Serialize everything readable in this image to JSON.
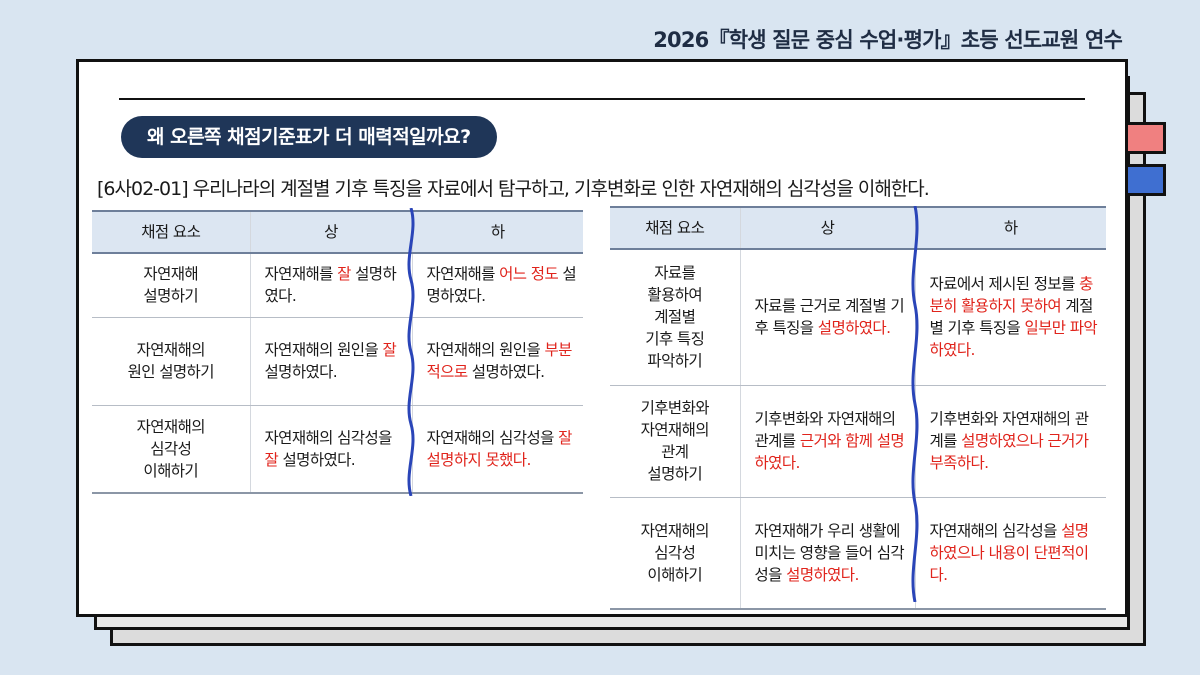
{
  "header": {
    "title": "2026『학생 질문 중심 수업·평가』초등 선도교원 연수"
  },
  "question": "왜 오른쪽 채점기준표가 더 매력적일까요?",
  "standard": "[6사02-01] 우리나라의 계절별 기후 특징을 자료에서 탐구하고, 기후변화로 인한 자연재해의 심각성을 이해한다.",
  "left_table": {
    "headers": [
      "채점 요소",
      "상",
      "하"
    ],
    "rows": [
      {
        "element": [
          "자연재해",
          "설명하기"
        ],
        "high": [
          {
            "t": "자연재해를 "
          },
          {
            "t": "잘",
            "r": 1
          },
          {
            "t": " 설명하였다."
          }
        ],
        "low": [
          {
            "t": "자연재해를 "
          },
          {
            "t": "어느 정도",
            "r": 1
          },
          {
            "t": " 설명하였다."
          }
        ]
      },
      {
        "element": [
          "자연재해의",
          "원인 설명하기"
        ],
        "high": [
          {
            "t": "자연재해의 원인을 "
          },
          {
            "t": "잘",
            "r": 1
          },
          {
            "t": " 설명하였다."
          }
        ],
        "low": [
          {
            "t": "자연재해의 원인을 "
          },
          {
            "t": "부분적으로",
            "r": 1
          },
          {
            "t": " 설명하였다."
          }
        ]
      },
      {
        "element": [
          "자연재해의",
          "심각성",
          "이해하기"
        ],
        "high": [
          {
            "t": "자연재해의 심각성을 "
          },
          {
            "t": "잘",
            "r": 1
          },
          {
            "t": " 설명하였다."
          }
        ],
        "low": [
          {
            "t": "자연재해의 심각성을 "
          },
          {
            "t": "잘 설명하지 못했다.",
            "r": 1
          }
        ]
      }
    ]
  },
  "right_table": {
    "headers": [
      "채점 요소",
      "상",
      "하"
    ],
    "rows": [
      {
        "element": [
          "자료를",
          "활용하여",
          "계절별",
          "기후 특징",
          "파악하기"
        ],
        "high": [
          {
            "t": "자료를 근거로 계절별 기후 특징을 "
          },
          {
            "t": "설명하였다.",
            "r": 1
          }
        ],
        "low": [
          {
            "t": "자료에서 제시된 정보를 "
          },
          {
            "t": "충분히 활용하지 못하여",
            "r": 1
          },
          {
            "t": " 계절별 기후 특징을 "
          },
          {
            "t": "일부만 파악하였다.",
            "r": 1
          }
        ]
      },
      {
        "element": [
          "기후변화와",
          "자연재해의",
          "관계",
          "설명하기"
        ],
        "high": [
          {
            "t": "기후변화와 자연재해의 관계를 "
          },
          {
            "t": "근거와 함께 설명하였다.",
            "r": 1
          }
        ],
        "low": [
          {
            "t": "기후변화와 자연재해의 관계를 "
          },
          {
            "t": "설명하였으나 근거가 부족하다.",
            "r": 1
          }
        ]
      },
      {
        "element": [
          "자연재해의",
          "심각성",
          "이해하기"
        ],
        "high": [
          {
            "t": "자연재해가 우리 생활에 미치는 영향을 들어 심각성을 "
          },
          {
            "t": "설명하였다.",
            "r": 1
          }
        ],
        "low": [
          {
            "t": "자연재해의 심각성을 "
          },
          {
            "t": "설명하였으나 내용이 단편적이다.",
            "r": 1
          }
        ]
      }
    ]
  },
  "colors": {
    "pill": "#1f3658",
    "highlight": "#e0241c",
    "wave": "#2a45b8",
    "tab_red": "#f08080",
    "tab_blue": "#3f6fd1"
  }
}
